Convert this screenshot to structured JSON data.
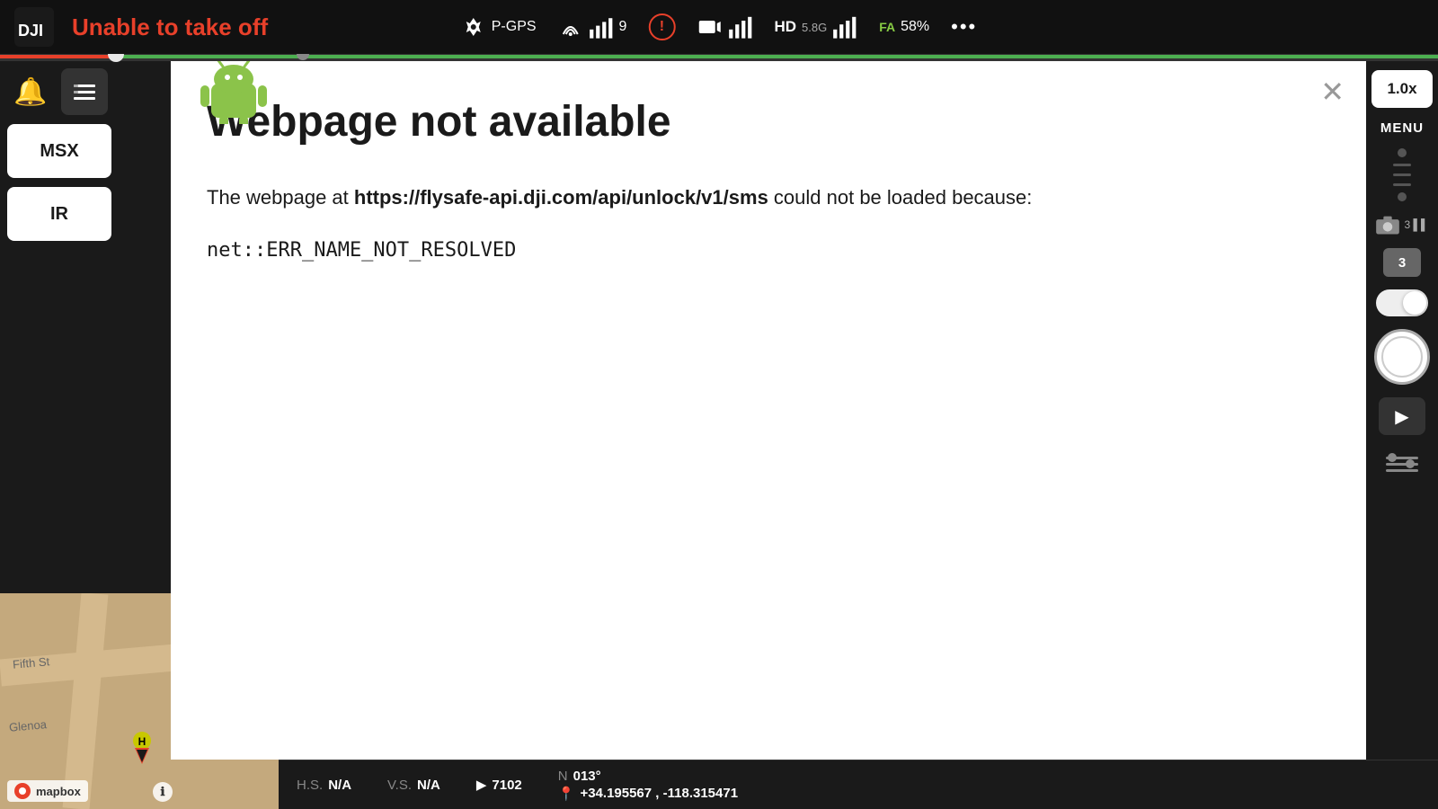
{
  "topbar": {
    "logo_alt": "DJI Logo",
    "warning_text": "Unable to take off",
    "gps_label": "P-GPS",
    "zoom_label": "1.0x",
    "menu_label": "MENU",
    "battery_pct": "58%",
    "hd_label": "HD",
    "fa_label": "FA",
    "three_dots": "•••"
  },
  "modal": {
    "title": "Webpage not available",
    "body_prefix": "The webpage at ",
    "url": "https://flysafe-api.dji.com/api/unlock/v1/sms",
    "body_suffix": " could not be loaded because:",
    "error_code": "net::ERR_NAME_NOT_RESOLVED",
    "close_label": "✕",
    "android_icon": "🤖"
  },
  "left_sidebar": {
    "bell_icon": "🔔",
    "list_icon": "≡",
    "msx_label": "MSX",
    "ir_label": "IR"
  },
  "right_sidebar": {
    "zoom_label": "1.0x",
    "menu_label": "MENU",
    "number_badge": "3",
    "play_icon": "▶"
  },
  "bottom_bar": {
    "hs_label": "H.S.",
    "hs_value": "N/A",
    "vs_label": "V.S.",
    "vs_value": "N/A",
    "flight_label": "▶",
    "flight_value": "7102",
    "n_label": "N",
    "heading": "013°",
    "pin_icon": "📍",
    "coords": "+34.195567 , -118.315471"
  },
  "map": {
    "street1": "Fifth St",
    "street2": "Glenoa",
    "h_marker": "H",
    "mapbox_label": "mapbox",
    "info_icon": "ℹ"
  },
  "slider": {
    "h_label": "H"
  }
}
